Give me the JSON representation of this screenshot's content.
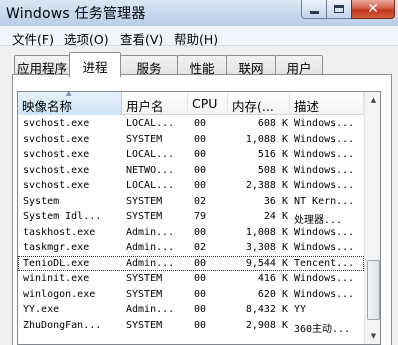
{
  "window": {
    "title": "Windows 任务管理器",
    "close_glyph": "✕"
  },
  "menu": [
    "文件(F)",
    "选项(O)",
    "查看(V)",
    "帮助(H)"
  ],
  "tabs": [
    {
      "label": "应用程序",
      "active": false
    },
    {
      "label": "进程",
      "active": true
    },
    {
      "label": "服务",
      "active": false
    },
    {
      "label": "性能",
      "active": false
    },
    {
      "label": "联网",
      "active": false
    },
    {
      "label": "用户",
      "active": false
    }
  ],
  "columns": {
    "image": "映像名称",
    "user": "用户名",
    "cpu": "CPU",
    "memory": "内存(...",
    "description": "描述"
  },
  "sort_glyph": "▲",
  "processes": [
    {
      "image": "svchost.exe",
      "user": "LOCAL...",
      "cpu": "00",
      "memory": "608 K",
      "description": "Windows..."
    },
    {
      "image": "svchost.exe",
      "user": "SYSTEM",
      "cpu": "00",
      "memory": "1,088 K",
      "description": "Windows..."
    },
    {
      "image": "svchost.exe",
      "user": "LOCAL...",
      "cpu": "00",
      "memory": "516 K",
      "description": "Windows..."
    },
    {
      "image": "svchost.exe",
      "user": "NETWO...",
      "cpu": "00",
      "memory": "508 K",
      "description": "Windows..."
    },
    {
      "image": "svchost.exe",
      "user": "LOCAL...",
      "cpu": "00",
      "memory": "2,388 K",
      "description": "Windows..."
    },
    {
      "image": "System",
      "user": "SYSTEM",
      "cpu": "02",
      "memory": "36 K",
      "description": "NT Kern..."
    },
    {
      "image": "System Idl...",
      "user": "SYSTEM",
      "cpu": "79",
      "memory": "24 K",
      "description": "处理器..."
    },
    {
      "image": "taskhost.exe",
      "user": "Admin...",
      "cpu": "00",
      "memory": "1,008 K",
      "description": "Windows..."
    },
    {
      "image": "taskmgr.exe",
      "user": "Admin...",
      "cpu": "02",
      "memory": "3,308 K",
      "description": "Windows..."
    },
    {
      "image": "TenioDL.exe",
      "user": "Admin...",
      "cpu": "00",
      "memory": "9,544 K",
      "description": "Tencent...",
      "selected": true
    },
    {
      "image": "wininit.exe",
      "user": "SYSTEM",
      "cpu": "00",
      "memory": "416 K",
      "description": "Windows..."
    },
    {
      "image": "winlogon.exe",
      "user": "SYSTEM",
      "cpu": "00",
      "memory": "620 K",
      "description": "Windows..."
    },
    {
      "image": "YY.exe",
      "user": "Admin...",
      "cpu": "00",
      "memory": "8,432 K",
      "description": "YY"
    },
    {
      "image": "ZhuDongFan...",
      "user": "SYSTEM",
      "cpu": "00",
      "memory": "2,908 K",
      "description": "360主动..."
    }
  ],
  "scrollbar": {
    "up_glyph": "▲",
    "down_glyph": "▼",
    "position_fraction": 0.8
  }
}
